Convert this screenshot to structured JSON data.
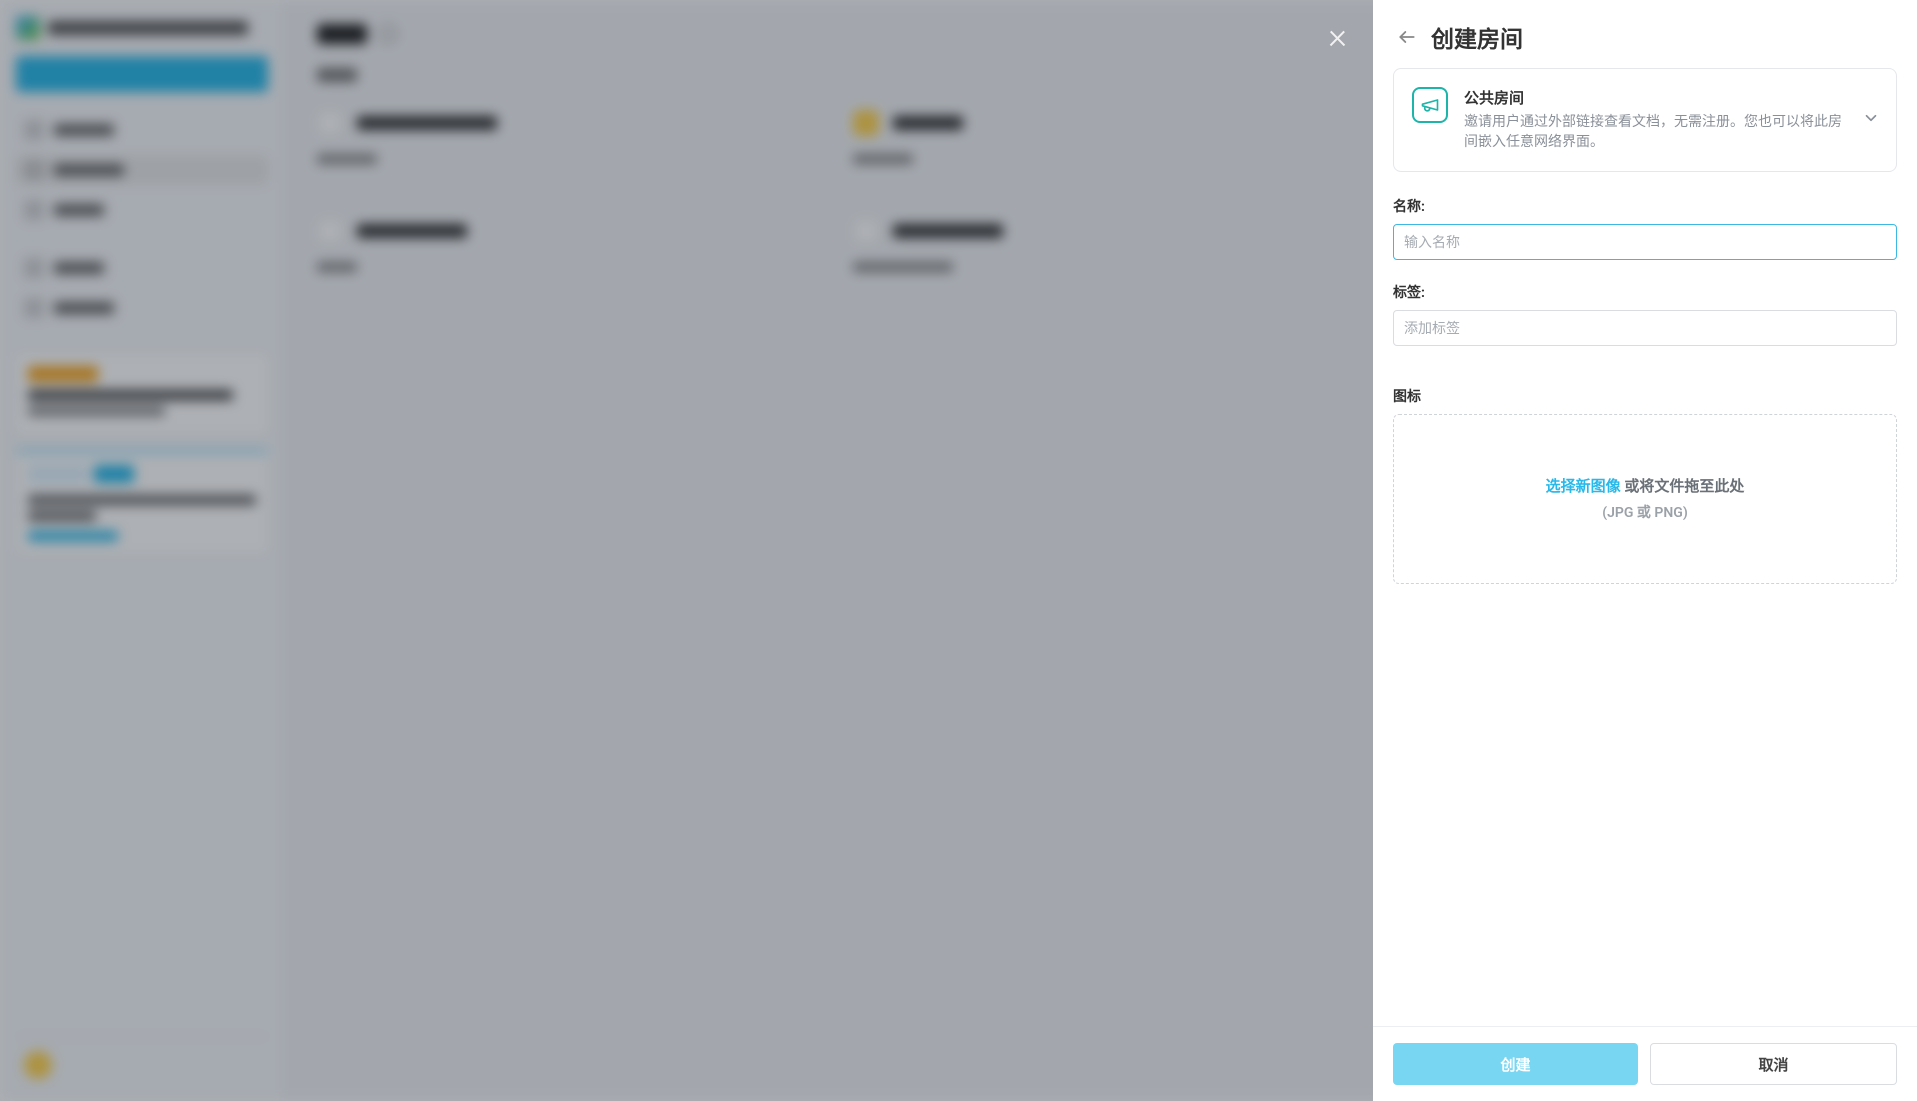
{
  "panel": {
    "title": "创建房间",
    "room_type": {
      "title": "公共房间",
      "description": "邀请用户通过外部链接查看文档，无需注册。您也可以将此房间嵌入任意网络界面。"
    },
    "name": {
      "label": "名称:",
      "placeholder": "输入名称",
      "value": ""
    },
    "tags": {
      "label": "标签:",
      "placeholder": "添加标签",
      "value": ""
    },
    "icon": {
      "label": "图标",
      "select_link": "选择新图像",
      "drag_text": " 或将文件拖至此处",
      "format_hint": "(JPG 或 PNG)"
    },
    "buttons": {
      "create": "创建",
      "cancel": "取消"
    }
  }
}
